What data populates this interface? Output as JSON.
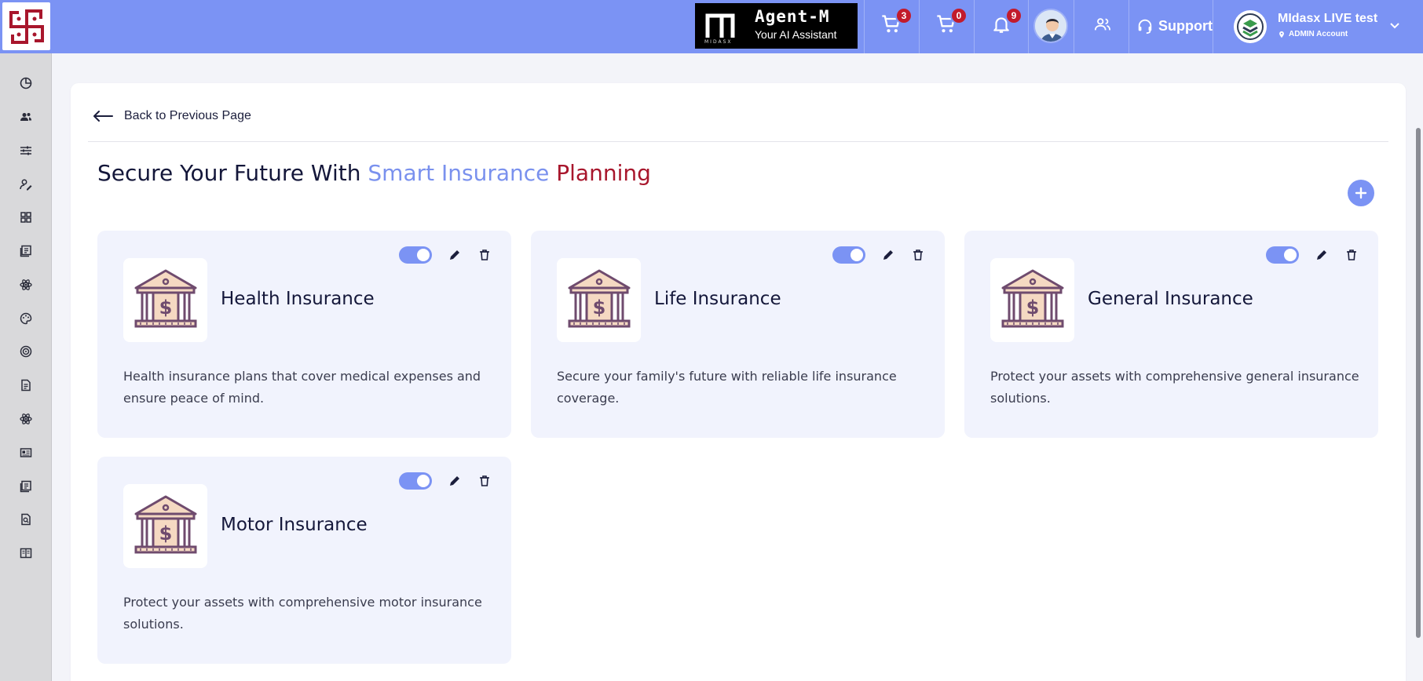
{
  "header": {
    "agent": {
      "mark_text": "MIDASX",
      "name": "Agent-M",
      "subtitle": "Your AI Assistant"
    },
    "cart1_count": "3",
    "cart2_count": "0",
    "notifications_count": "9",
    "support_label": "Support",
    "account": {
      "name": "MIdasx LIVE test",
      "role": "ADMIN Account"
    }
  },
  "sidebar": {
    "items": [
      {
        "icon": "pie-chart-icon"
      },
      {
        "icon": "users-icon"
      },
      {
        "icon": "sliders-icon"
      },
      {
        "icon": "user-edit-icon"
      },
      {
        "icon": "grid-icon"
      },
      {
        "icon": "report-icon"
      },
      {
        "icon": "atom-icon"
      },
      {
        "icon": "palette-icon"
      },
      {
        "icon": "target-icon"
      },
      {
        "icon": "document-icon"
      },
      {
        "icon": "atom-icon"
      },
      {
        "icon": "id-card-icon"
      },
      {
        "icon": "report-icon"
      },
      {
        "icon": "search-doc-icon"
      },
      {
        "icon": "book-icon"
      }
    ]
  },
  "main": {
    "back_label": "Back to Previous Page",
    "title_part1": "Secure Your Future With ",
    "title_part2": "Smart Insurance ",
    "title_part3": "Planning",
    "cards": [
      {
        "name": "Health Insurance",
        "description": "Health insurance plans that cover medical expenses and ensure peace of mind.",
        "enabled": true
      },
      {
        "name": "Life Insurance",
        "description": "Secure your family's future with reliable life insurance coverage.",
        "enabled": true
      },
      {
        "name": "General Insurance",
        "description": "Protect your assets with comprehensive general insurance solutions.",
        "enabled": true
      },
      {
        "name": "Motor Insurance",
        "description": "Protect your assets with comprehensive motor insurance solutions.",
        "enabled": true
      }
    ]
  },
  "colors": {
    "header_bg": "#7b93f4",
    "accent_blue": "#7a91ee",
    "accent_red": "#a8162c",
    "badge_red": "#c21b2c",
    "card_bg": "#f1f3fd"
  }
}
